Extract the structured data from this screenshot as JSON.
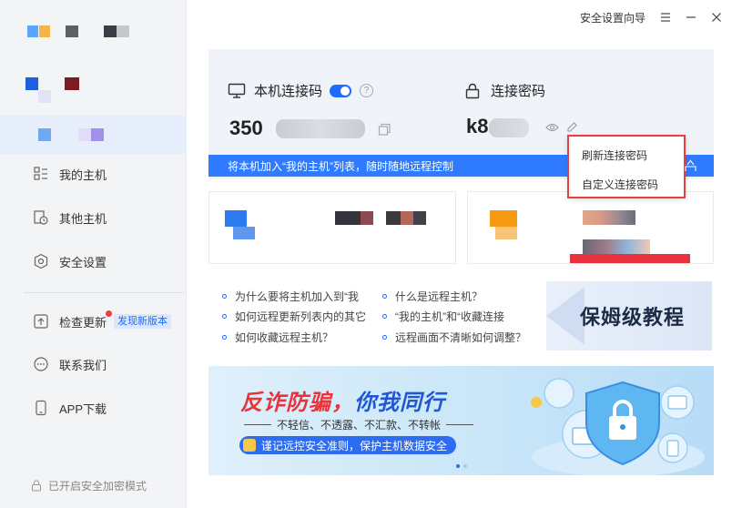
{
  "titlebar": {
    "guide_label": "安全设置向导",
    "menu_icon": "menu-icon",
    "minimize_icon": "minimize-icon",
    "close_icon": "close-icon"
  },
  "sidebar": {
    "nav": [
      {
        "id": "my-hosts",
        "label": "我的主机",
        "icon": "grid-list-icon"
      },
      {
        "id": "other-hosts",
        "label": "其他主机",
        "icon": "history-icon"
      },
      {
        "id": "settings",
        "label": "安全设置",
        "icon": "hexagon-settings-icon"
      },
      {
        "id": "update",
        "label": "检查更新",
        "icon": "upload-icon",
        "tag": "发现新版本"
      },
      {
        "id": "contact",
        "label": "联系我们",
        "icon": "chat-icon"
      },
      {
        "id": "app",
        "label": "APP下载",
        "icon": "phone-icon"
      }
    ],
    "security_mode": "已开启安全加密模式"
  },
  "connection": {
    "code_label": "本机连接码",
    "code_prefix": "350",
    "password_label": "连接密码",
    "password_prefix": "k8",
    "help_glyph": "?",
    "strip_text": "将本机加入“我的主机”列表，随时随地远程控制"
  },
  "password_menu": {
    "refresh": "刷新连接密码",
    "custom": "自定义连接密码"
  },
  "faq": [
    "为什么要将主机加入到“我",
    "如何远程更新列表内的其它",
    "如何收藏远程主机？",
    "什么是远程主机？",
    "“我的主机”和“收藏连接",
    "远程画面不清晰如何调整？"
  ],
  "tutorial": "保姆级教程",
  "banner": {
    "title_red": "反诈防骗，",
    "title_blue": "你我同行",
    "subtitle": "不轻信、不透露、不汇款、不转帐",
    "pill": "谨记远控安全准则，保护主机数据安全"
  },
  "colors": {
    "accent": "#1f6bff",
    "alert": "#e84040",
    "sidebar_bg": "#f3f4f6"
  }
}
